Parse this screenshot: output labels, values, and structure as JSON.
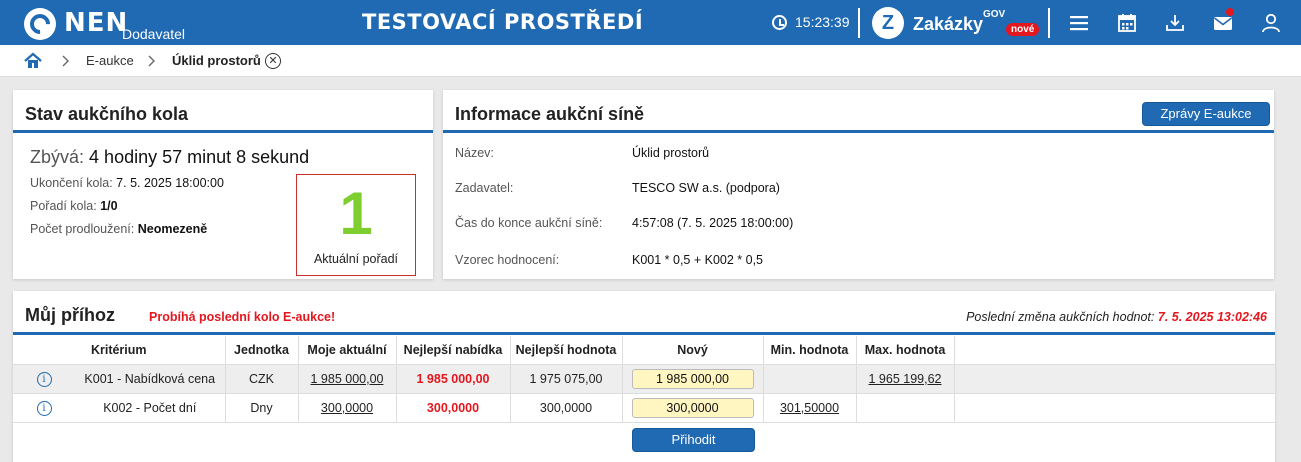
{
  "header": {
    "logo_text": "NEN",
    "logo_sub": "Dodavatel",
    "env_title": "TESTOVACÍ PROSTŘEDÍ",
    "time": "15:23:39",
    "zakazky_text": "Zakázky",
    "zakazky_gov": "GOV",
    "zakazky_badge": "nové",
    "zakazky_letter": "Z"
  },
  "breadcrumb": {
    "items": [
      "E-aukce",
      "Úklid prostorů"
    ],
    "close_symbol": "✕"
  },
  "round_status": {
    "title": "Stav aukčního kola",
    "remaining_label": "Zbývá:",
    "remaining_value": "4 hodiny 57 minut 8 sekund",
    "end_label": "Ukončení kola:",
    "end_value": "7. 5. 2025 18:00:00",
    "order_label": "Pořadí kola:",
    "order_value": "1/0",
    "ext_label": "Počet prodloužení:",
    "ext_value": "Neomezeně",
    "rank_value": "1",
    "rank_label": "Aktuální pořadí"
  },
  "room_info": {
    "title": "Informace aukční síně",
    "button_label": "Zprávy E-aukce",
    "rows": [
      {
        "label": "Název:",
        "value": "Úklid prostorů"
      },
      {
        "label": "Zadavatel:",
        "value": "TESCO SW a.s. (podpora)"
      },
      {
        "label": "Čas do konce aukční síně:",
        "value": "4:57:08 (7. 5. 2025 18:00:00)"
      },
      {
        "label": "Vzorec hodnocení:",
        "value": "K001 * 0,5 + K002 * 0,5"
      }
    ]
  },
  "my_bid": {
    "title": "Můj příhoz",
    "last_round_note": "Probíhá poslední kolo E-aukce!",
    "last_change_label": "Poslední změna aukčních hodnot:",
    "last_change_value": "7. 5. 2025 13:02:46",
    "columns": [
      "Kritérium",
      "Jednotka",
      "Moje aktuální",
      "Nejlepší nabídka",
      "Nejlepší hodnota",
      "Nový",
      "Min. hodnota",
      "Max. hodnota"
    ],
    "rows": [
      {
        "criterion": "K001 - Nabídková cena",
        "unit": "CZK",
        "my_current": "1 985 000,00",
        "best_offer": "1 985 000,00",
        "best_value": "1 975 075,00",
        "new": "1 985 000,00",
        "min": "",
        "max": "1 965 199,62"
      },
      {
        "criterion": "K002 - Počet dní",
        "unit": "Dny",
        "my_current": "300,0000",
        "best_offer": "300,0000",
        "best_value": "300,0000",
        "new": "300,0000",
        "min": "301,50000",
        "max": ""
      }
    ],
    "submit_label": "Přihodit",
    "info_symbol": "i"
  },
  "colors": {
    "brand": "#1f6ab3",
    "alert": "#e4171f",
    "rank": "#7fce2f",
    "input_bg": "#fff6c2"
  },
  "icons": [
    "clock-icon",
    "menu-icon",
    "calendar-icon",
    "download-icon",
    "mail-icon",
    "user-icon",
    "home-icon",
    "chevron-right-icon",
    "close-icon",
    "info-icon"
  ]
}
